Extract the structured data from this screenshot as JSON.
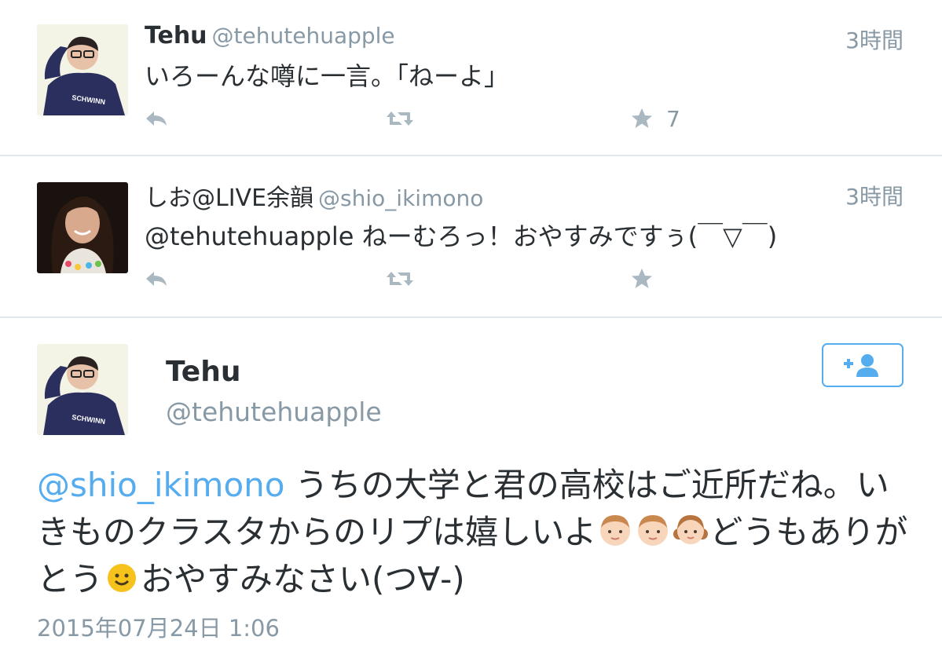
{
  "tweets": [
    {
      "name": "Tehu",
      "handle": "@tehutehuapple",
      "time": "3時間",
      "text": "いろーんな噂に一言。「ねーよ」",
      "fav_count": "7",
      "avatar": "avatar-tehu"
    },
    {
      "name": "しお@LIVE余韻",
      "handle": "@shio_ikimono",
      "time": "3時間",
      "text": "@tehutehuapple ねーむろっ！おやすみですぅ(￣▽￣)",
      "avatar": "avatar-shio"
    }
  ],
  "main_tweet": {
    "name": "Tehu",
    "handle": "@tehutehuapple",
    "mention": "@shio_ikimono",
    "text_part1": " うちの大学と君の高校はご近所だね。いきものクラスタからのリプは嬉しいよ",
    "text_part2": "どうもありがとう",
    "text_part3": "おやすみなさい(つ∀-)",
    "date": "2015年07月24日 1:06",
    "follow_icon": "follow-add-user-icon"
  },
  "icons": {
    "reply": "reply-icon",
    "retweet": "retweet-icon",
    "favorite": "star-icon"
  },
  "colors": {
    "link": "#55acee",
    "secondary_text": "#8899a6",
    "action_icon": "#aab8c2",
    "divider": "#e1e8ed"
  }
}
